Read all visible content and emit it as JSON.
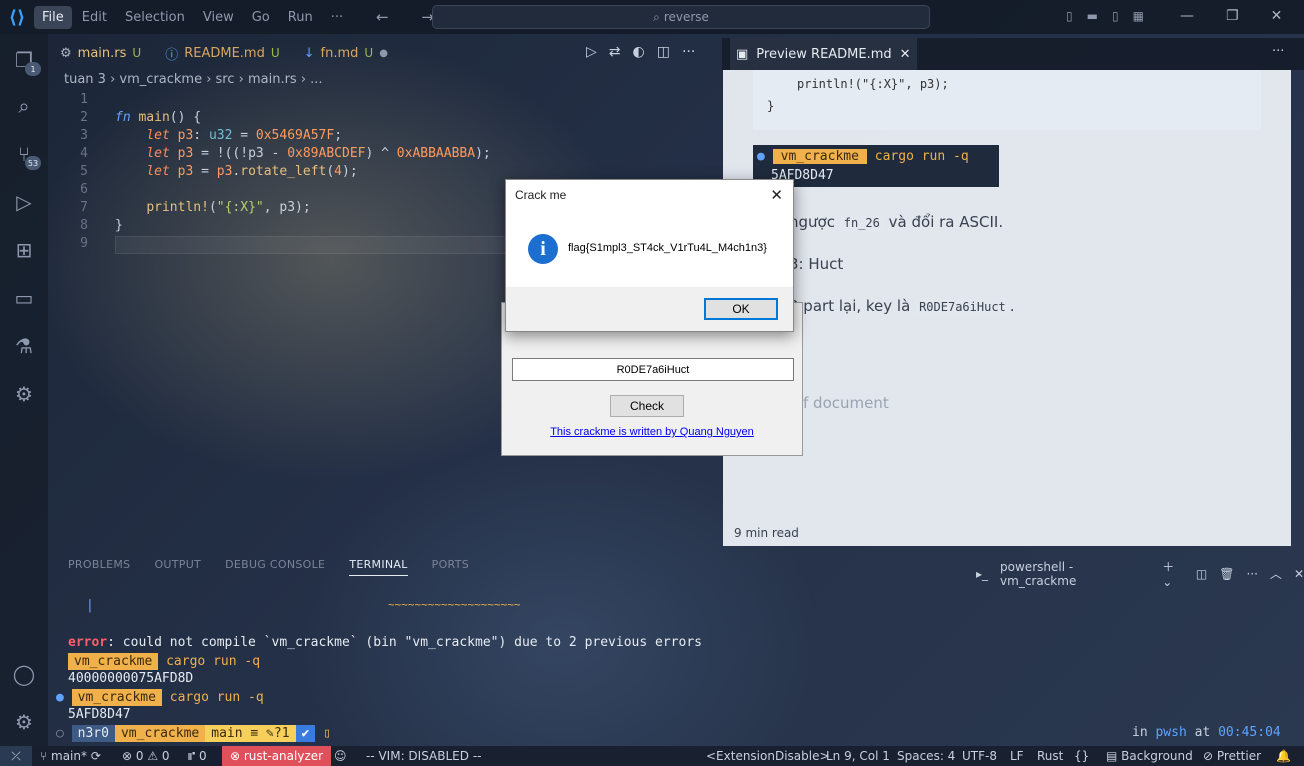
{
  "titlebar": {
    "logo": "VS",
    "menu": [
      "File",
      "Edit",
      "Selection",
      "View",
      "Go",
      "Run",
      "···"
    ],
    "nav": "← →",
    "search": "reverse",
    "window_controls": [
      "—",
      "❐",
      "✕"
    ]
  },
  "activity": {
    "explorer_badge": "1",
    "scm_badge": "53"
  },
  "editor": {
    "tabs": [
      {
        "name": "main.rs",
        "status": "U",
        "icon": "rust-icon"
      },
      {
        "name": "README.md",
        "status": "U",
        "icon": "info-icon"
      },
      {
        "name": "fn.md",
        "status": "U",
        "icon": "markdown-icon"
      }
    ],
    "breadcrumb": "tuan 3 › vm_crackme › src › main.rs › ...",
    "line_numbers": [
      "1",
      "2",
      "3",
      "4",
      "5",
      "6",
      "7",
      "8",
      "9"
    ]
  },
  "preview": {
    "tab_title": "Preview README.md",
    "code_line": "println!(\"{:X}\", p3);",
    "code_close": "}",
    "term_chip": "vm_crackme",
    "term_cmd": "cargo run -q",
    "term_out": "5AFD8D47",
    "p1_text": "ngược",
    "p1_code": "fn_26",
    "p1_rest": "và đổi ra ASCII.",
    "p2": "3: Huct",
    "p3_text": "3 part lại, key là",
    "p3_code": "R0DE7a6iHuct",
    "p4": "f document",
    "read_time": "9 min read"
  },
  "crackme": {
    "key_value": "R0DE7a6iHuct",
    "check_label": "Check",
    "credit": "This crackme is written by Quang Nguyen"
  },
  "msgbox": {
    "title": "Crack me",
    "message": "flag{S1mpl3_ST4ck_V1rTu4L_M4ch1n3}",
    "ok_label": "OK"
  },
  "panel": {
    "tabs": [
      "PROBLEMS",
      "OUTPUT",
      "DEBUG CONSOLE",
      "TERMINAL",
      "PORTS"
    ],
    "active_tab": "TERMINAL",
    "terminal_name": "powershell - vm_crackme"
  },
  "terminal": {
    "squiggle": "~~~~~~~~~~~~~~~~~~~~",
    "error_label": "error",
    "error_msg": ": could not compile `vm_crackme` (bin \"vm_crackme\") due to 2 previous errors",
    "chip": "vm_crackme",
    "cmd": "cargo run -q",
    "out1": "40000000075AFD8D",
    "out2": "5AFD8D47",
    "user": "n3r0",
    "dir": "vm_crackme",
    "git": "main ≡ ✎?1",
    "check": "✔",
    "right_prefix": "in",
    "shell": "pwsh",
    "at": "at",
    "time": "00:45:04"
  },
  "statusbar": {
    "branch": "main*",
    "errors": "⊗ 0 ⚠ 0",
    "ports": "⑈ 0",
    "analyzer": "rust-analyzer",
    "vim": "-- VIM: DISABLED --",
    "extension": "<ExtensionDisable>",
    "position": "Ln 9, Col 1",
    "spaces": "Spaces: 4",
    "encoding": "UTF-8",
    "eol": "LF",
    "language": "Rust",
    "background": "Background",
    "prettier": "Prettier"
  }
}
